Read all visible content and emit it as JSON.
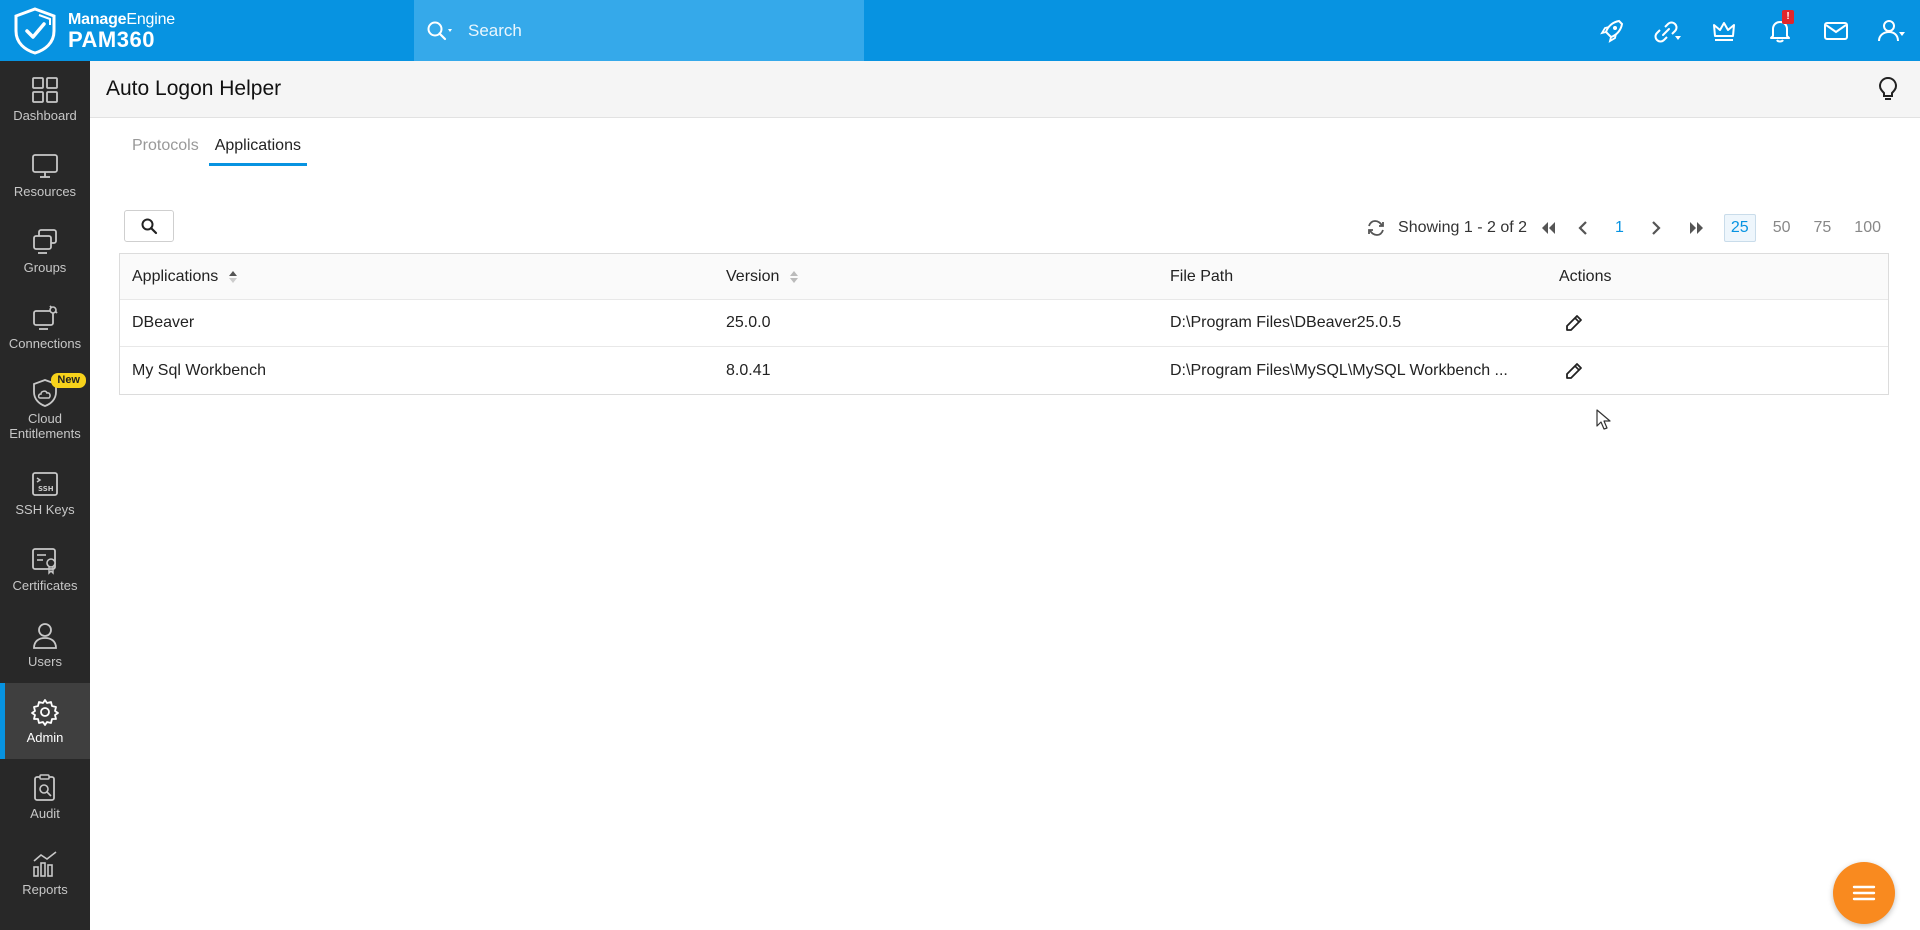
{
  "brand": {
    "vendor_strong": "Manage",
    "vendor_light": "Engine",
    "product": "PAM360"
  },
  "search": {
    "placeholder": "Search"
  },
  "top_icons": [
    "rocket-icon",
    "link-icon",
    "crown-icon",
    "bell-icon",
    "mail-icon",
    "user-icon"
  ],
  "notification_badge": "!",
  "sidebar": {
    "items": [
      {
        "label": "Dashboard",
        "icon": "dashboard-icon"
      },
      {
        "label": "Resources",
        "icon": "monitor-icon"
      },
      {
        "label": "Groups",
        "icon": "groups-icon"
      },
      {
        "label": "Connections",
        "icon": "connections-icon"
      },
      {
        "label": "Cloud Entitlements",
        "icon": "cloud-shield-icon",
        "badge": "New"
      },
      {
        "label": "SSH Keys",
        "icon": "ssh-icon"
      },
      {
        "label": "Certificates",
        "icon": "certificate-icon"
      },
      {
        "label": "Users",
        "icon": "user-icon"
      },
      {
        "label": "Admin",
        "icon": "gear-icon",
        "active": true
      },
      {
        "label": "Audit",
        "icon": "audit-icon"
      },
      {
        "label": "Reports",
        "icon": "reports-icon"
      }
    ]
  },
  "page": {
    "title": "Auto Logon Helper"
  },
  "tabs": [
    {
      "label": "Protocols",
      "active": false
    },
    {
      "label": "Applications",
      "active": true
    }
  ],
  "pager": {
    "summary": "Showing 1 - 2 of 2",
    "current_page": "1",
    "page_sizes": [
      "25",
      "50",
      "75",
      "100"
    ],
    "active_size": "25"
  },
  "table": {
    "columns": [
      "Applications",
      "Version",
      "File Path",
      "Actions"
    ],
    "rows": [
      {
        "application": "DBeaver",
        "version": "25.0.0",
        "path": "D:\\Program Files\\DBeaver25.0.5"
      },
      {
        "application": "My Sql Workbench",
        "version": "8.0.41",
        "path": "D:\\Program Files\\MySQL\\MySQL Workbench ..."
      }
    ]
  },
  "colors": {
    "topbar": "#0793e1",
    "search_bg": "#35a9ea",
    "sidebar": "#282828",
    "accent": "#0793e1",
    "fab": "#f98a1f",
    "new_badge": "#f7d21b"
  }
}
